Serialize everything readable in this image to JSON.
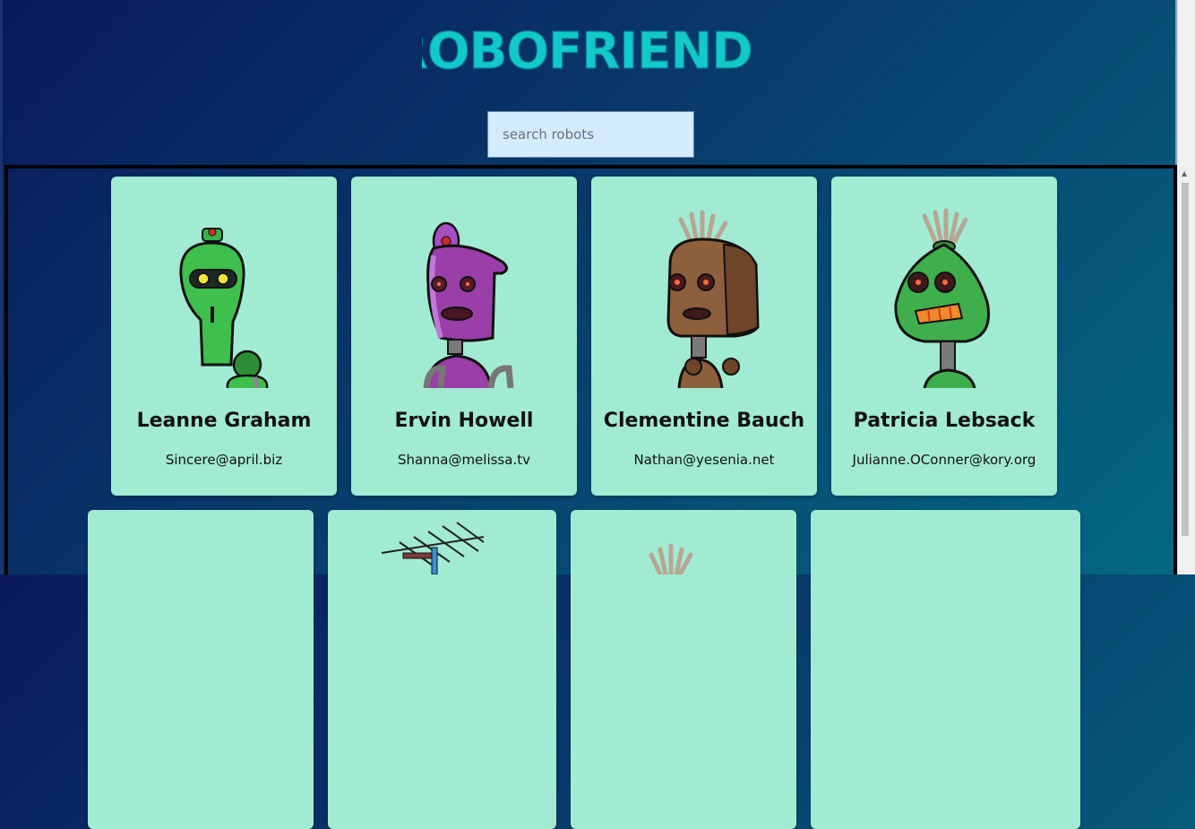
{
  "header": {
    "title": "ROBOFRIENDS"
  },
  "search": {
    "placeholder": "search robots"
  },
  "robots": [
    {
      "name": "Leanne Graham",
      "email": "Sincere@april.biz"
    },
    {
      "name": "Ervin Howell",
      "email": "Shanna@melissa.tv"
    },
    {
      "name": "Clementine Bauch",
      "email": "Nathan@yesenia.net"
    },
    {
      "name": "Patricia Lebsack",
      "email": "Julianne.OConner@kory.org"
    }
  ],
  "colors": {
    "title": "#12c9c9",
    "card": "#a2ebd3",
    "search_bg": "#d3ecff"
  }
}
